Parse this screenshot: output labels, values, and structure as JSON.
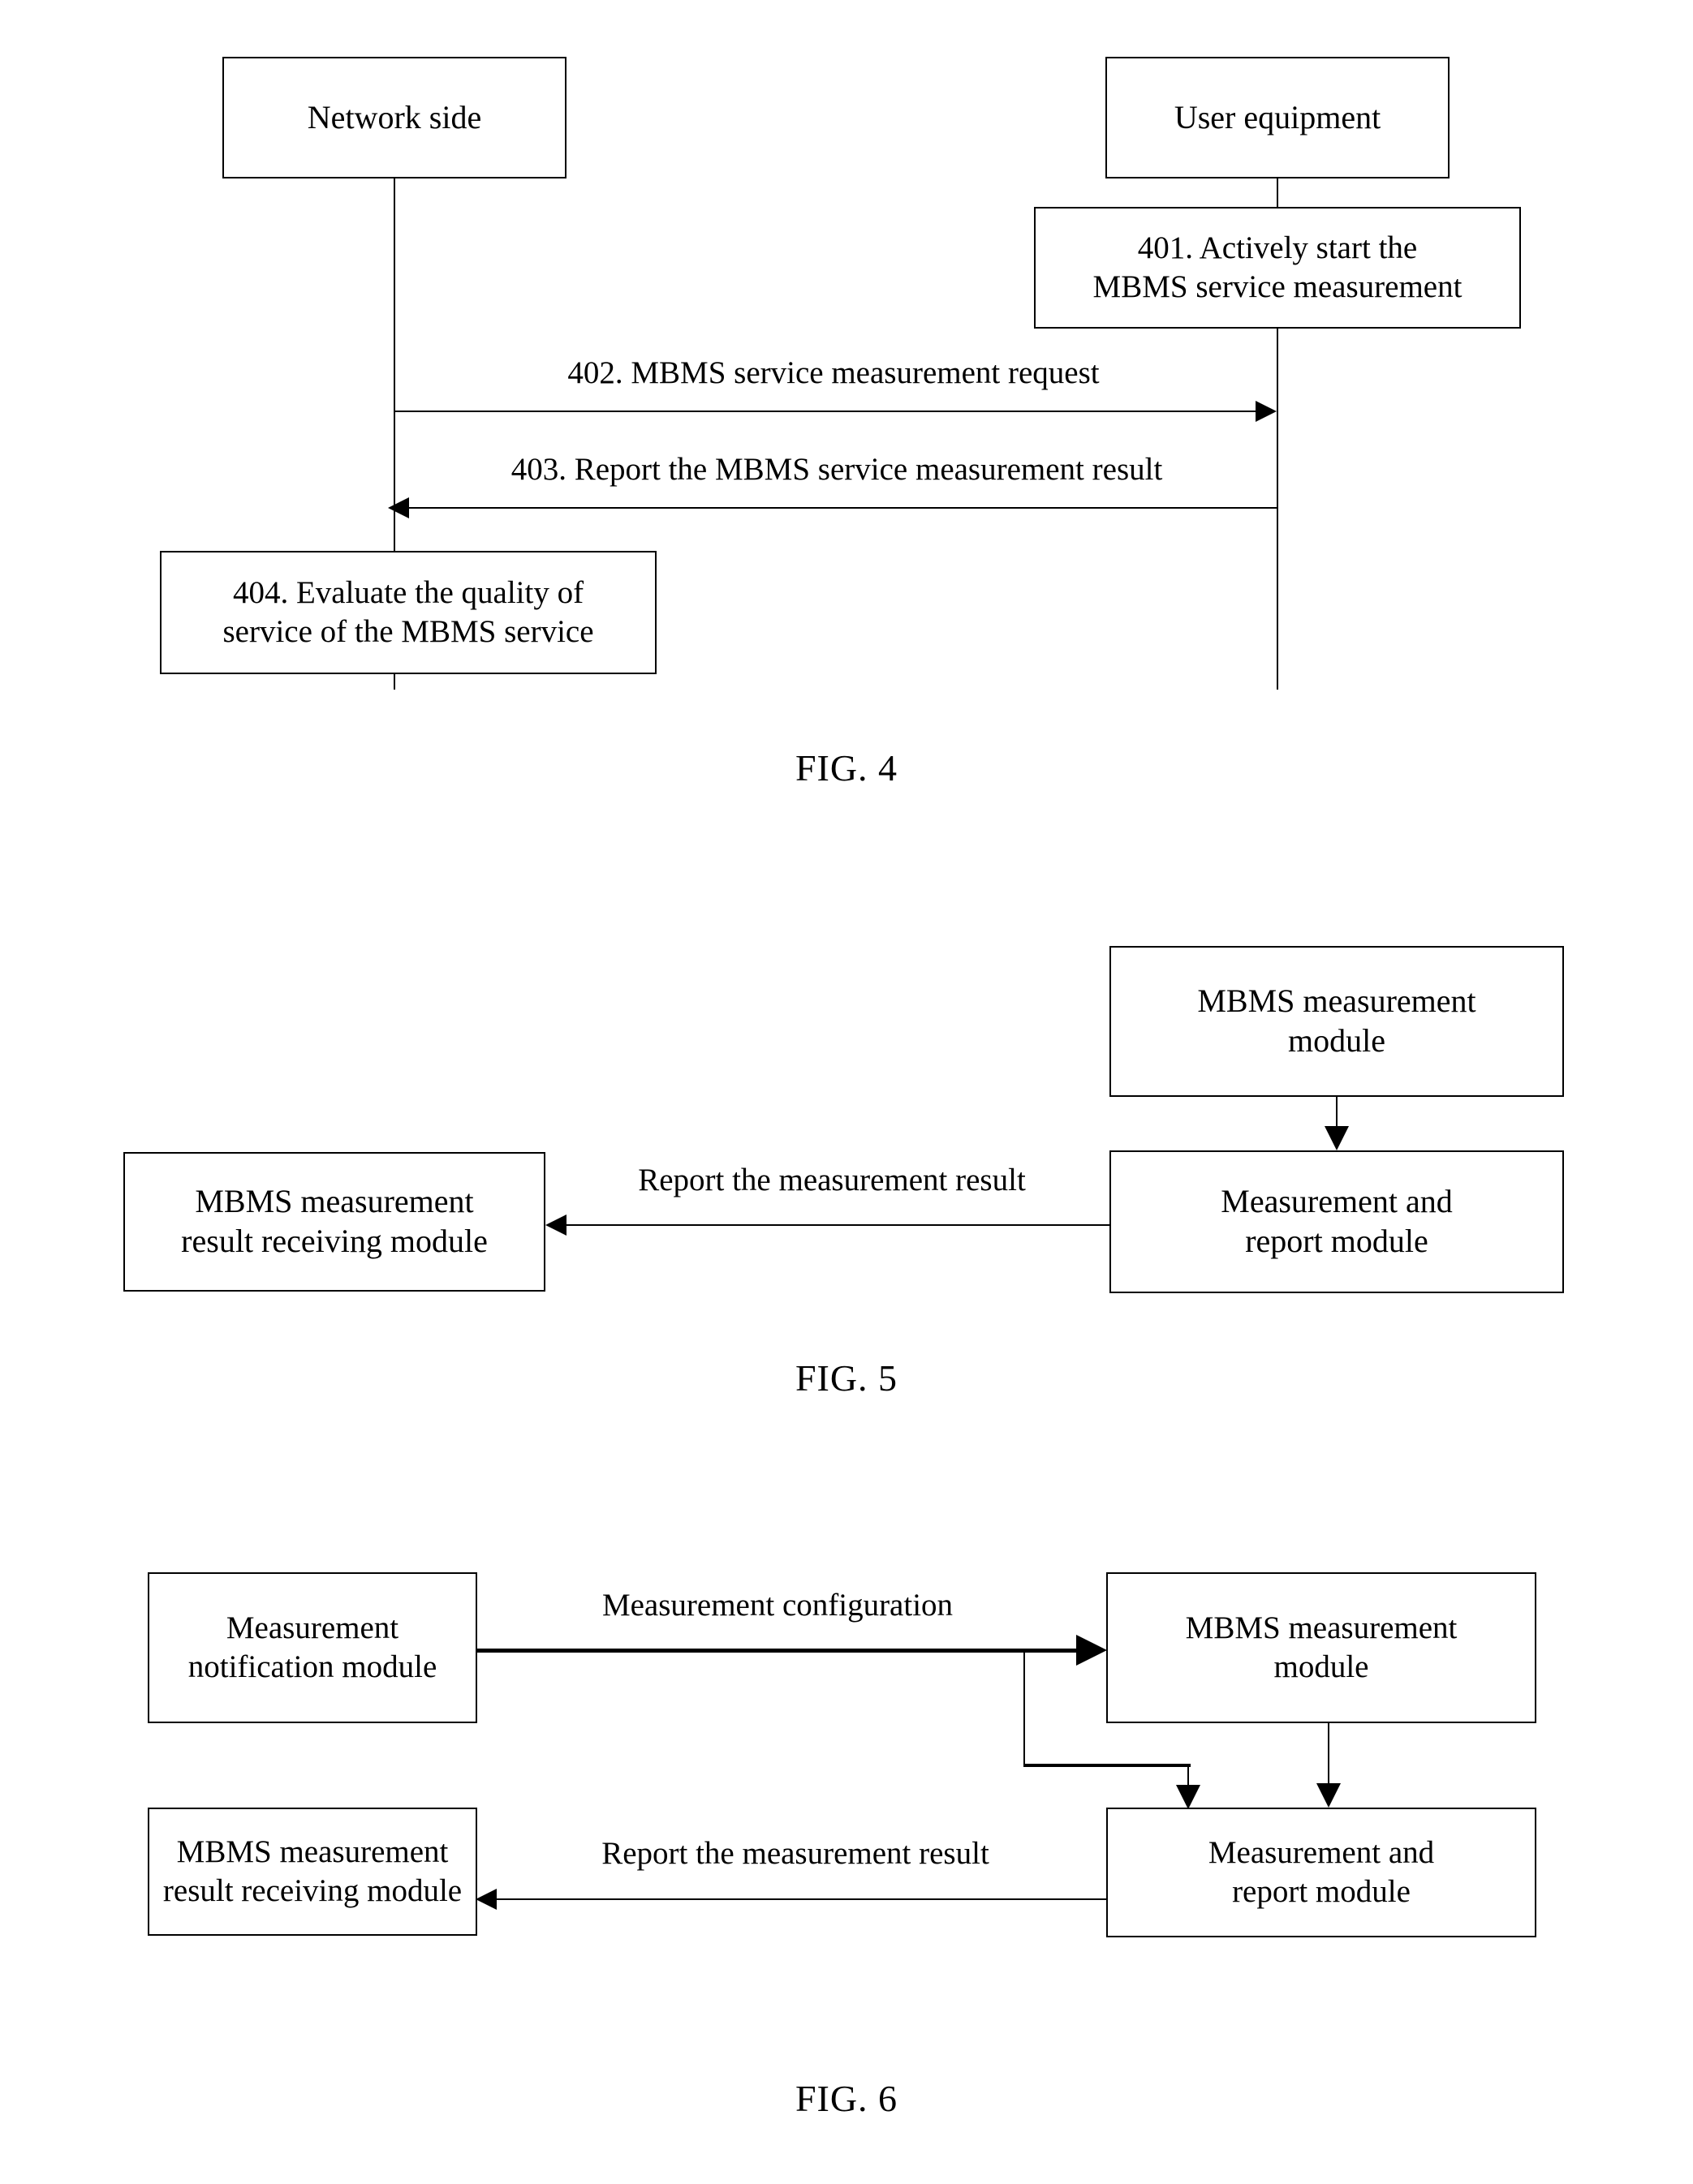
{
  "figures": [
    {
      "caption": "FIG. 4",
      "type": "sequence-diagram",
      "lifelines": [
        {
          "label": "Network side"
        },
        {
          "label": "User equipment"
        }
      ],
      "steps": [
        {
          "id": "401",
          "text": "401. Actively start the MBMS service measurement",
          "line1": "401. Actively start the",
          "line2": "MBMS service measurement",
          "kind": "activity-box",
          "actor": "User equipment"
        },
        {
          "id": "402",
          "text": "402. MBMS service measurement request",
          "kind": "message",
          "direction": "right",
          "from": "Network side",
          "to": "User equipment"
        },
        {
          "id": "403",
          "text": "403. Report the MBMS service measurement result",
          "kind": "message",
          "direction": "left",
          "from": "User equipment",
          "to": "Network side"
        },
        {
          "id": "404",
          "text": "404. Evaluate the quality of service of the MBMS service",
          "line1": "404. Evaluate the quality of",
          "line2": "service of the MBMS service",
          "kind": "activity-box",
          "actor": "Network side"
        }
      ]
    },
    {
      "caption": "FIG. 5",
      "type": "block-diagram",
      "blocks": [
        {
          "id": "mbms-measurement-module",
          "line1": "MBMS measurement",
          "line2": "module"
        },
        {
          "id": "measurement-and-report-module",
          "line1": "Measurement and",
          "line2": "report module"
        },
        {
          "id": "mbms-measurement-result-receiving-module",
          "line1": "MBMS measurement",
          "line2": "result receiving module"
        }
      ],
      "edges": [
        {
          "from": "mbms-measurement-module",
          "to": "measurement-and-report-module",
          "label": "",
          "direction": "down"
        },
        {
          "from": "measurement-and-report-module",
          "to": "mbms-measurement-result-receiving-module",
          "label": "Report the measurement result",
          "direction": "left"
        }
      ]
    },
    {
      "caption": "FIG. 6",
      "type": "block-diagram",
      "blocks": [
        {
          "id": "measurement-notification-module",
          "line1": "Measurement",
          "line2": "notification module"
        },
        {
          "id": "mbms-measurement-module",
          "line1": "MBMS measurement",
          "line2": "module"
        },
        {
          "id": "measurement-and-report-module",
          "line1": "Measurement and",
          "line2": "report module"
        },
        {
          "id": "mbms-measurement-result-receiving-module",
          "line1": "MBMS measurement",
          "line2": "result receiving module"
        }
      ],
      "edges": [
        {
          "from": "measurement-notification-module",
          "to": "mbms-measurement-module",
          "label": "Measurement configuration",
          "direction": "right"
        },
        {
          "from": "measurement-notification-module",
          "to": "measurement-and-report-module",
          "label": "",
          "direction": "down"
        },
        {
          "from": "mbms-measurement-module",
          "to": "measurement-and-report-module",
          "label": "",
          "direction": "down"
        },
        {
          "from": "measurement-and-report-module",
          "to": "mbms-measurement-result-receiving-module",
          "label": "Report the measurement result",
          "direction": "left"
        }
      ]
    }
  ],
  "fig4": {
    "network_side": "Network side",
    "user_equipment": "User equipment",
    "step401_line1": "401. Actively start the",
    "step401_line2": "MBMS service measurement",
    "step402": "402. MBMS service measurement request",
    "step403": "403. Report the MBMS service measurement result",
    "step404_line1": "404. Evaluate the quality of",
    "step404_line2": "service of the MBMS service",
    "caption": "FIG. 4"
  },
  "fig5": {
    "mbms_measurement_module_l1": "MBMS measurement",
    "mbms_measurement_module_l2": "module",
    "measurement_report_module_l1": "Measurement and",
    "measurement_report_module_l2": "report module",
    "result_receiving_module_l1": "MBMS measurement",
    "result_receiving_module_l2": "result receiving module",
    "report_label": "Report the measurement result",
    "caption": "FIG. 5"
  },
  "fig6": {
    "notification_module_l1": "Measurement",
    "notification_module_l2": "notification module",
    "mbms_measurement_module_l1": "MBMS measurement",
    "mbms_measurement_module_l2": "module",
    "measurement_report_module_l1": "Measurement and",
    "measurement_report_module_l2": "report module",
    "result_receiving_module_l1": "MBMS measurement",
    "result_receiving_module_l2": "result receiving module",
    "config_label": "Measurement configuration",
    "report_label": "Report the measurement result",
    "caption": "FIG. 6"
  }
}
